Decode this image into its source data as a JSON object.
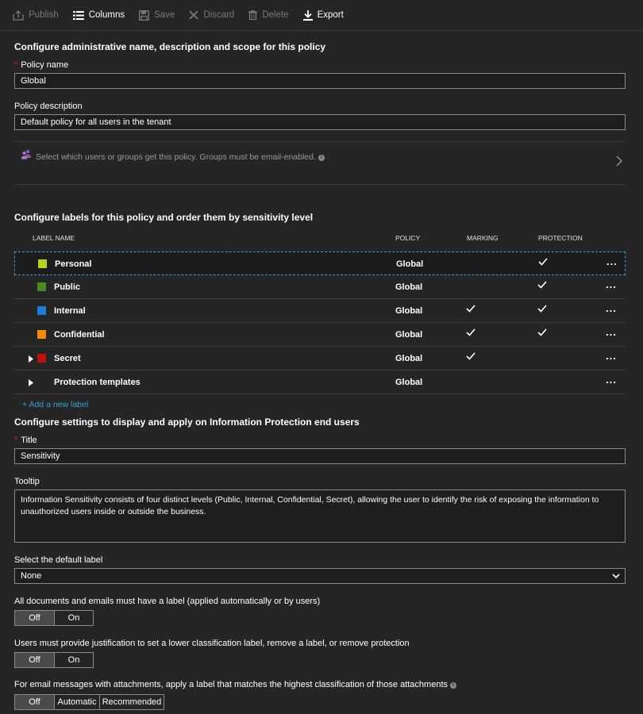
{
  "toolbar": {
    "publish": "Publish",
    "columns": "Columns",
    "save": "Save",
    "discard": "Discard",
    "delete": "Delete",
    "export": "Export"
  },
  "admin": {
    "heading": "Configure administrative name, description and scope for this policy",
    "policy_name_label": "Policy name",
    "policy_name_value": "Global",
    "policy_desc_label": "Policy description",
    "policy_desc_value": "Default policy for all users in the tenant",
    "scope_text": "Select which users or groups get this policy. Groups must be email-enabled."
  },
  "labels": {
    "heading": "Configure labels for this policy and order them by sensitivity level",
    "columns": [
      "LABEL NAME",
      "POLICY",
      "MARKING",
      "PROTECTION"
    ],
    "rows": [
      {
        "name": "Personal",
        "policy": "Global",
        "marking": false,
        "protection": true,
        "color": "#b5d31c",
        "expandable": false,
        "selected": true
      },
      {
        "name": "Public",
        "policy": "Global",
        "marking": false,
        "protection": true,
        "color": "#4a8a24",
        "expandable": false,
        "selected": false
      },
      {
        "name": "Internal",
        "policy": "Global",
        "marking": true,
        "protection": true,
        "color": "#1e7bd6",
        "expandable": false,
        "selected": false
      },
      {
        "name": "Confidential",
        "policy": "Global",
        "marking": true,
        "protection": true,
        "color": "#f08c0a",
        "expandable": false,
        "selected": false
      },
      {
        "name": "Secret",
        "policy": "Global",
        "marking": true,
        "protection": false,
        "color": "#c01010",
        "expandable": true,
        "selected": false
      },
      {
        "name": "Protection templates",
        "policy": "Global",
        "marking": false,
        "protection": false,
        "color": "",
        "expandable": true,
        "selected": false
      }
    ],
    "more_label": "...",
    "add_label": "+ Add a new label"
  },
  "settings": {
    "heading": "Configure settings to display and apply on Information Protection end users",
    "title_label": "Title",
    "title_value": "Sensitivity",
    "tooltip_label": "Tooltip",
    "tooltip_value": "Information Sensitivity consists of four distinct levels (Public, Internal, Confidential, Secret), allowing the user to identify the risk of exposing the information to unauthorized users inside or outside the business.",
    "default_label_label": "Select the default label",
    "default_label_value": "None",
    "mandatory_label": "All documents and emails must have a label (applied automatically or by users)",
    "mandatory_options": [
      "Off",
      "On"
    ],
    "justification_label": "Users must provide justification to set a lower classification label, remove a label, or remove protection",
    "justification_options": [
      "Off",
      "On"
    ],
    "attachments_label": "For email messages with attachments, apply a label that matches the highest classification of those attachments",
    "attachments_options": [
      "Off",
      "Automatic",
      "Recommended"
    ],
    "selected_option": "Off"
  }
}
